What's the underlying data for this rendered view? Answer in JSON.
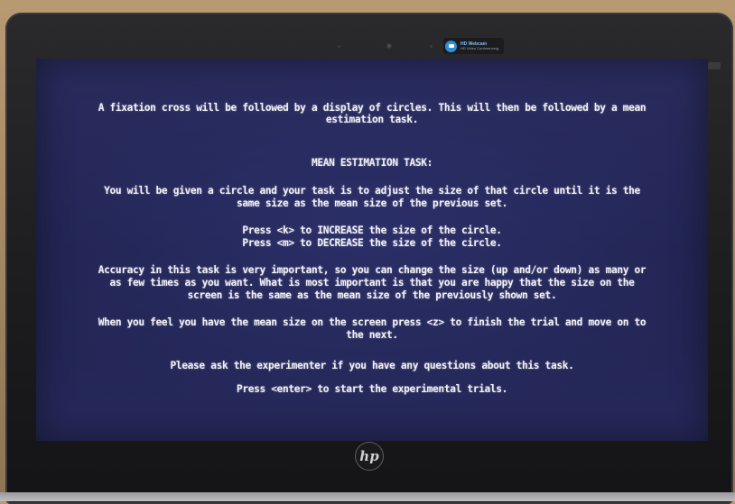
{
  "screen": {
    "lines": [
      "A fixation cross will be followed by a display of circles. This will then be followed by a mean",
      "estimation task.",
      "MEAN ESTIMATION TASK:",
      "You will be given a circle and your task is to adjust the size of that circle until it is the",
      "same size as the mean size of the previous set.",
      "Press <k> to INCREASE the size of the circle.",
      "Press <m> to DECREASE the size of the circle.",
      "Accuracy in this task is very important, so you can change the size (up and/or down) as many or",
      "as few times as you want. What is most important is that you are happy that the size on the",
      "screen is the same as the mean size of the previously shown set.",
      "When you feel you have the mean size on the screen press <z> to finish the trial and move on to",
      "the next.",
      "Please ask the experimenter if you have any questions about this task.",
      "Press <enter> to start the experimental trials."
    ]
  },
  "notification": {
    "title": "HD Webcam",
    "subtitle": "HD Video Conferencing",
    "icon": "webcam-icon",
    "accent": "#2f8fd9"
  },
  "bezel": {
    "logo_text": "hp"
  },
  "colors": {
    "screen_bg": "#23264f",
    "text": "#f2f2f6",
    "bezel": "#1c1c1e"
  }
}
